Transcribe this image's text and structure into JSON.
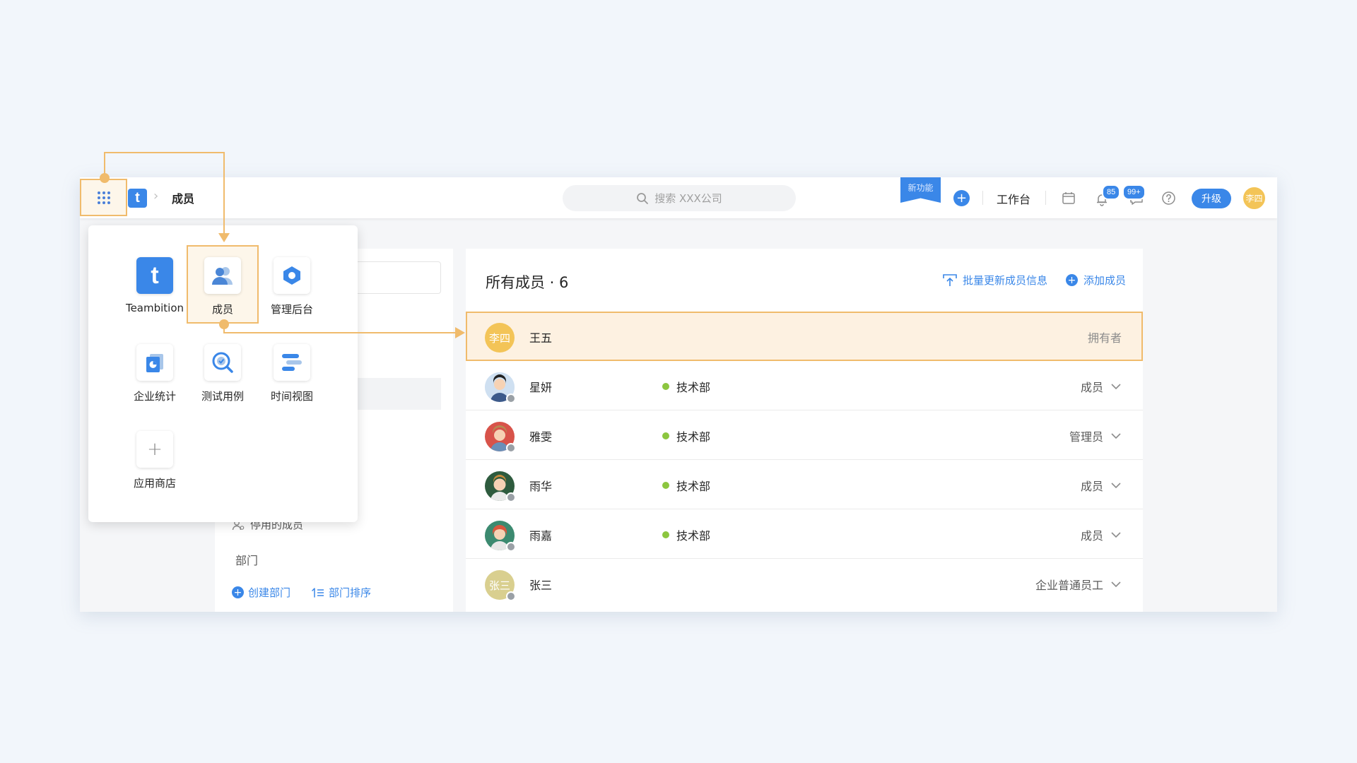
{
  "topbar": {
    "breadcrumb_logo": "t",
    "breadcrumb_current": "成员",
    "search_placeholder": "搜索 XXX公司",
    "new_feature_label": "新功能",
    "add_icon": "plus-icon",
    "workbench_label": "工作台",
    "notification_count": "85",
    "message_count": "99+",
    "upgrade_label": "升级",
    "avatar_text": "李四"
  },
  "app_menu": {
    "apps": [
      {
        "label": "Teambition",
        "icon": "teambition-icon"
      },
      {
        "label": "成员",
        "icon": "members-icon"
      },
      {
        "label": "管理后台",
        "icon": "admin-icon"
      },
      {
        "label": "企业统计",
        "icon": "stats-icon"
      },
      {
        "label": "测试用例",
        "icon": "testcase-icon"
      },
      {
        "label": "时间视图",
        "icon": "timeline-icon"
      },
      {
        "label": "应用商店",
        "icon": "add-app-icon"
      }
    ]
  },
  "sidebar": {
    "disabled_members_label": "停用的成员",
    "department_title": "部门",
    "create_department_label": "创建部门",
    "sort_department_label": "部门排序"
  },
  "member_list": {
    "title": "所有成员 · 6",
    "batch_update_label": "批量更新成员信息",
    "add_member_label": "添加成员",
    "members": [
      {
        "name": "王五",
        "avatar_text": "李四",
        "department": "",
        "role": "拥有者"
      },
      {
        "name": "星妍",
        "avatar_text": "",
        "department": "技术部",
        "role": "成员"
      },
      {
        "name": "雅雯",
        "avatar_text": "",
        "department": "技术部",
        "role": "管理员"
      },
      {
        "name": "雨华",
        "avatar_text": "",
        "department": "技术部",
        "role": "成员"
      },
      {
        "name": "雨嘉",
        "avatar_text": "",
        "department": "技术部",
        "role": "成员"
      },
      {
        "name": "张三",
        "avatar_text": "张三",
        "department": "",
        "role": "企业普通员工"
      }
    ]
  },
  "colors": {
    "accent": "#3a87e8",
    "highlight": "#f0bb6c",
    "highlight_bg": "#fdf1e1",
    "status_green": "#8cc63f"
  }
}
